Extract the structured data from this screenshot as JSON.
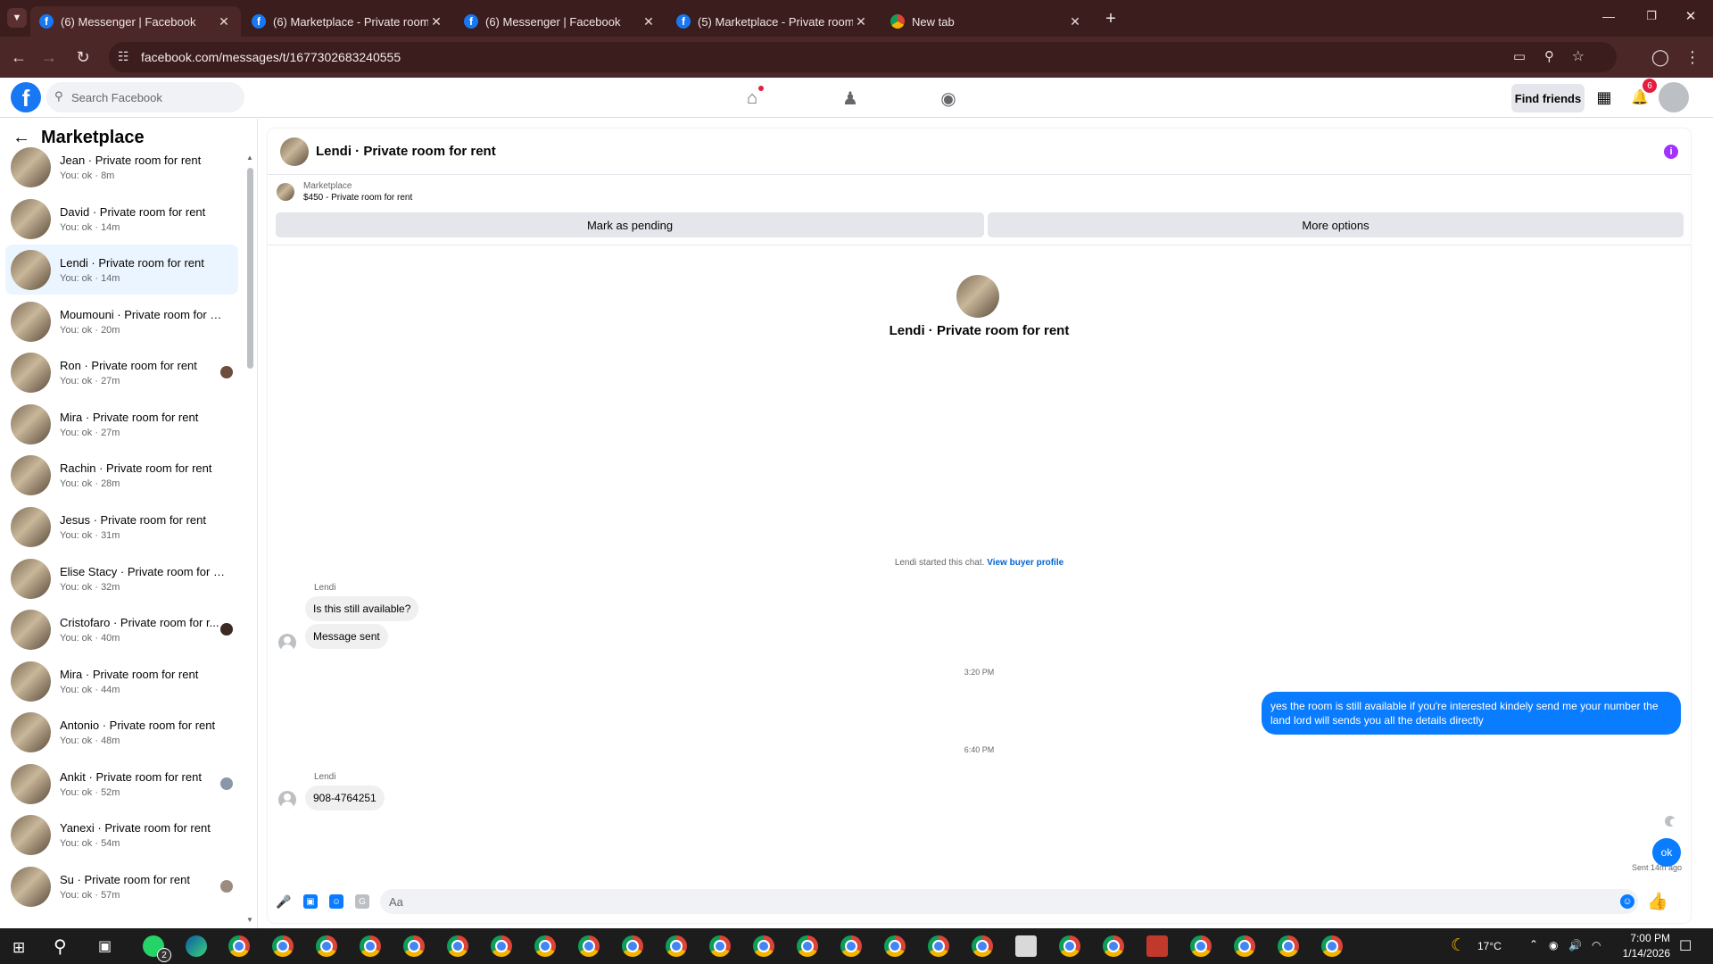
{
  "browser": {
    "tabs": [
      {
        "title": "(6) Messenger | Facebook",
        "icon": "facebook-icon",
        "active": true
      },
      {
        "title": "(6) Marketplace - Private room",
        "icon": "facebook-icon",
        "active": false
      },
      {
        "title": "(6) Messenger | Facebook",
        "icon": "facebook-icon",
        "active": false
      },
      {
        "title": "(5) Marketplace - Private room",
        "icon": "facebook-icon",
        "active": false
      },
      {
        "title": "New tab",
        "icon": "chrome-icon",
        "active": false
      }
    ],
    "url": "facebook.com/messages/t/1677302683240555"
  },
  "fb": {
    "search_placeholder": "Search Facebook",
    "find_friends": "Find friends",
    "notif_count": "6"
  },
  "sidebar": {
    "title": "Marketplace",
    "chats": [
      {
        "name": "Jean · Private room for rent",
        "sub": "You: ok · 8m"
      },
      {
        "name": "David · Private room for rent",
        "sub": "You: ok · 14m"
      },
      {
        "name": "Lendi · Private room for rent",
        "sub": "You: ok · 14m",
        "selected": true
      },
      {
        "name": "Moumouni · Private room for re...",
        "sub": "You: ok · 20m"
      },
      {
        "name": "Ron · Private room for rent",
        "sub": "You: ok · 27m"
      },
      {
        "name": "Mira · Private room for rent",
        "sub": "You: ok · 27m"
      },
      {
        "name": "Rachin · Private room for rent",
        "sub": "You: ok · 28m"
      },
      {
        "name": "Jesus · Private room for rent",
        "sub": "You: ok · 31m"
      },
      {
        "name": "Elise Stacy · Private room for rent",
        "sub": "You: ok · 32m"
      },
      {
        "name": "Cristofaro · Private room for r...",
        "sub": "You: ok · 40m"
      },
      {
        "name": "Mira · Private room for rent",
        "sub": "You: ok · 44m"
      },
      {
        "name": "Antonio · Private room for rent",
        "sub": "You: ok · 48m"
      },
      {
        "name": "Ankit · Private room for rent",
        "sub": "You: ok · 52m"
      },
      {
        "name": "Yanexi · Private room for rent",
        "sub": "You: ok · 54m"
      },
      {
        "name": "Su · Private room for rent",
        "sub": "You: ok · 57m"
      }
    ]
  },
  "conversation": {
    "title": "Lendi · Private room for rent",
    "listing_source": "Marketplace",
    "listing_line": "$450 - Private room for rent",
    "mark_pending": "Mark as pending",
    "more_options": "More options",
    "profile_name": "Lendi · Private room for rent",
    "started_text": "Lendi started this chat.",
    "view_profile": "View buyer profile",
    "sender1": "Lendi",
    "msg1": "Is this still available?",
    "msg2": "Message sent",
    "time1": "3:20 PM",
    "out1": "yes the room is still available if you're interested kindely send me your number the land lord will sends you all the details directly",
    "time2": "6:40 PM",
    "sender2": "Lendi",
    "msg3": "908-4764251",
    "out2": "ok",
    "sent_status": "Sent 14m ago",
    "composer_placeholder": "Aa"
  },
  "taskbar": {
    "whatsapp_badge": "2",
    "temperature": "17°C",
    "time": "7:00 PM",
    "date": "1/14/2026"
  }
}
